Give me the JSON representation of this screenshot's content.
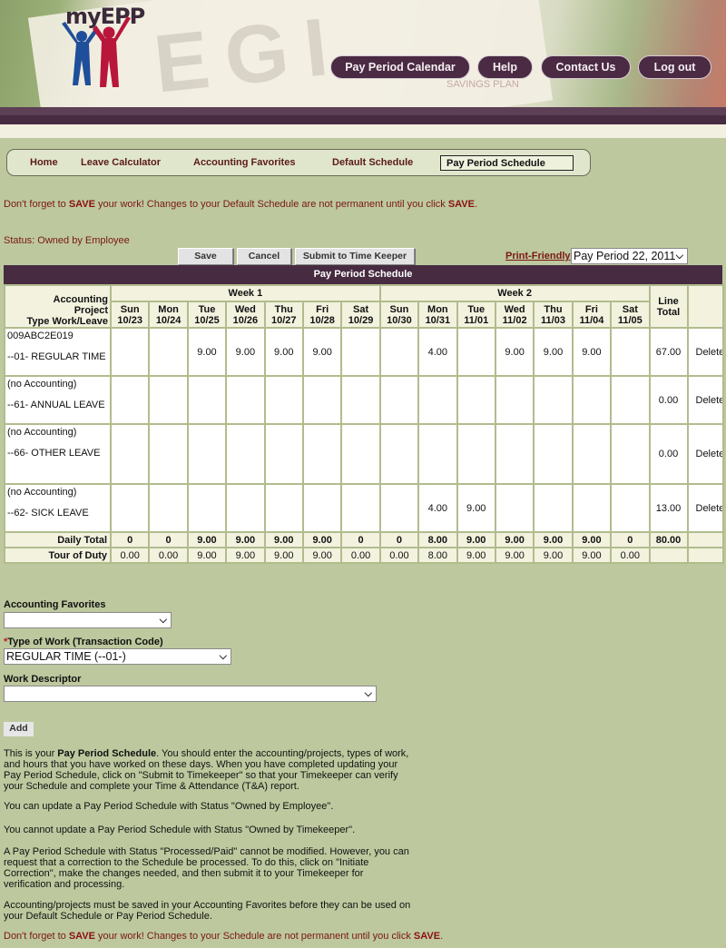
{
  "header": {
    "logo_text": "myEPP",
    "banner_watermark": "SAVINGS PLAN",
    "nav": [
      {
        "label": "Pay Period Calendar"
      },
      {
        "label": "Help"
      },
      {
        "label": "Contact Us"
      },
      {
        "label": "Log out"
      }
    ]
  },
  "subnav": {
    "items": [
      {
        "label": "Home"
      },
      {
        "label": "Leave Calculator"
      },
      {
        "label": "Accounting Favorites"
      },
      {
        "label": "Default Schedule"
      },
      {
        "label": "Pay Period Schedule",
        "active": true
      }
    ]
  },
  "top_warning": {
    "pre": "Don't forget to ",
    "b1": "SAVE",
    "mid": " your work! Changes to your Default Schedule are not permanent until you click ",
    "b2": "SAVE",
    "post": "."
  },
  "status": "Status: Owned by Employee",
  "toolbar": {
    "save": "Save",
    "cancel": "Cancel",
    "submit": "Submit to Time Keeper",
    "print_friendly": "Print-Friendly",
    "pay_period_selected": "Pay Period 22, 2011"
  },
  "schedule": {
    "title": "Pay Period Schedule",
    "rowhead": [
      "Accounting",
      "Project",
      "Type Work/Leave"
    ],
    "week1_label": "Week 1",
    "week2_label": "Week 2",
    "line_total_label": [
      "Line",
      "Total"
    ],
    "days": [
      {
        "dow": "Sun",
        "date": "10/23"
      },
      {
        "dow": "Mon",
        "date": "10/24"
      },
      {
        "dow": "Tue",
        "date": "10/25"
      },
      {
        "dow": "Wed",
        "date": "10/26"
      },
      {
        "dow": "Thu",
        "date": "10/27"
      },
      {
        "dow": "Fri",
        "date": "10/28"
      },
      {
        "dow": "Sat",
        "date": "10/29"
      },
      {
        "dow": "Sun",
        "date": "10/30"
      },
      {
        "dow": "Mon",
        "date": "10/31"
      },
      {
        "dow": "Tue",
        "date": "11/01"
      },
      {
        "dow": "Wed",
        "date": "11/02"
      },
      {
        "dow": "Thu",
        "date": "11/03"
      },
      {
        "dow": "Fri",
        "date": "11/04"
      },
      {
        "dow": "Sat",
        "date": "11/05"
      }
    ],
    "rows": [
      {
        "accounting": "009ABC2E019",
        "type": "--01- REGULAR TIME",
        "hours": [
          "",
          "",
          "9.00",
          "9.00",
          "9.00",
          "9.00",
          "",
          "",
          "4.00",
          "",
          "9.00",
          "9.00",
          "9.00",
          ""
        ],
        "total": "67.00",
        "action": "Delete"
      },
      {
        "accounting": "(no Accounting)",
        "type": "--61- ANNUAL LEAVE",
        "hours": [
          "",
          "",
          "",
          "",
          "",
          "",
          "",
          "",
          "",
          "",
          "",
          "",
          "",
          ""
        ],
        "total": "0.00",
        "action": "Delete"
      },
      {
        "accounting": "(no Accounting)",
        "type": "--66- OTHER LEAVE",
        "hours": [
          "",
          "",
          "",
          "",
          "",
          "",
          "",
          "",
          "",
          "",
          "",
          "",
          "",
          ""
        ],
        "total": "0.00",
        "action": "Delete"
      },
      {
        "accounting": "(no Accounting)",
        "type": "--62- SICK LEAVE",
        "hours": [
          "",
          "",
          "",
          "",
          "",
          "",
          "",
          "",
          "4.00",
          "9.00",
          "",
          "",
          "",
          ""
        ],
        "total": "13.00",
        "action": "Delete"
      }
    ],
    "daily_total": {
      "label": "Daily Total",
      "values": [
        "0",
        "0",
        "9.00",
        "9.00",
        "9.00",
        "9.00",
        "0",
        "0",
        "8.00",
        "9.00",
        "9.00",
        "9.00",
        "9.00",
        "0"
      ],
      "grand_total": "80.00"
    },
    "tour_of_duty": {
      "label": "Tour of Duty",
      "values": [
        "0.00",
        "0.00",
        "9.00",
        "9.00",
        "9.00",
        "9.00",
        "0.00",
        "0.00",
        "8.00",
        "9.00",
        "9.00",
        "9.00",
        "9.00",
        "0.00"
      ]
    }
  },
  "form": {
    "accounting_favorites_label": "Accounting Favorites",
    "accounting_favorites_value": "",
    "type_of_work_required": "*",
    "type_of_work_label": "Type of Work (Transaction Code)",
    "type_of_work_value": "REGULAR TIME (--01-)",
    "work_descriptor_label": "Work Descriptor",
    "work_descriptor_value": "",
    "add_button": "Add"
  },
  "help": {
    "p1_pre": "This is your ",
    "p1_bold": "Pay Period Schedule",
    "p1_post": ". You should enter the accounting/projects, types of work, and hours that you have worked on these days. When you have completed updating your Pay Period Schedule, click on \"Submit to Timekeeper\" so that your Timekeeper can verify your Schedule and complete your Time & Attendance (T&A) report.",
    "p2": "You can update a Pay Period Schedule with Status \"Owned by Employee\".",
    "p3": "You cannot update a Pay Period Schedule with Status \"Owned by Timekeeper\".",
    "p4": "A Pay Period Schedule with Status \"Processed/Paid\" cannot be modified. However, you can request that a correction to the Schedule be processed. To do this, click on \"Initiate Correction\", make the changes needed, and then submit it to your Timekeeper for verification and processing.",
    "p5": "Accounting/projects must be saved in your Accounting Favorites before they can be used on your Default Schedule or Pay Period Schedule."
  },
  "bottom_warning": {
    "pre": "Don't forget to ",
    "b1": "SAVE",
    "mid": " your work! Changes to your Schedule are not permanent until you click ",
    "b2": "SAVE",
    "post": "."
  },
  "colors": {
    "page_bg": "#bdc89e",
    "brand_purple": "#472b41",
    "warning_red": "#7a1616",
    "header_cell_bg": "#f3f2df"
  }
}
